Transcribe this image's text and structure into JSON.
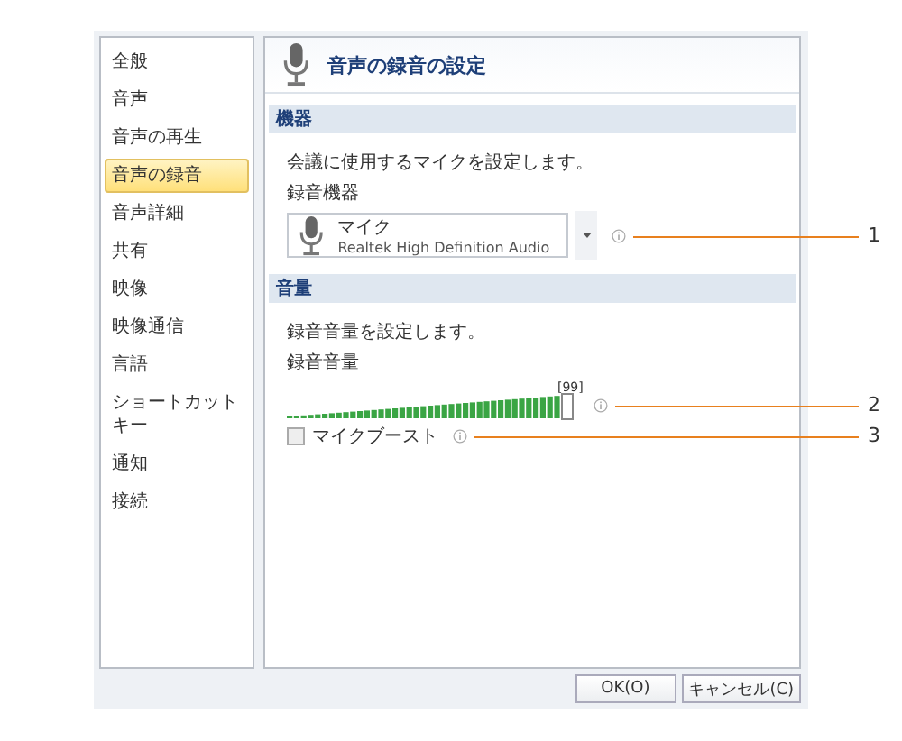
{
  "sidebar": {
    "items": [
      {
        "label": "全般",
        "selected": false
      },
      {
        "label": "音声",
        "selected": false
      },
      {
        "label": "音声の再生",
        "selected": false
      },
      {
        "label": "音声の録音",
        "selected": true
      },
      {
        "label": "音声詳細",
        "selected": false
      },
      {
        "label": "共有",
        "selected": false
      },
      {
        "label": "映像",
        "selected": false
      },
      {
        "label": "映像通信",
        "selected": false
      },
      {
        "label": "言語",
        "selected": false
      },
      {
        "label": "ショートカットキー",
        "selected": false
      },
      {
        "label": "通知",
        "selected": false
      },
      {
        "label": "接続",
        "selected": false
      }
    ]
  },
  "panel": {
    "title": "音声の録音の設定",
    "sections": [
      {
        "kind": "device",
        "heading": "機器",
        "description": "会議に使用するマイクを設定します。",
        "field_label": "録音機器",
        "device": {
          "name": "マイク",
          "detail": "Realtek High Definition Audio"
        }
      },
      {
        "kind": "volume",
        "heading": "音量",
        "description": "録音音量を設定します。",
        "field_label": "録音音量",
        "reading": "[99]",
        "level": 0.99,
        "checkbox": {
          "label": "マイクブースト",
          "checked": false
        }
      }
    ]
  },
  "buttons": [
    {
      "label": "OK(O)"
    },
    {
      "label": "キャンセル(C)"
    }
  ],
  "callouts": [
    {
      "label": "1"
    },
    {
      "label": "2"
    },
    {
      "label": "3"
    }
  ]
}
